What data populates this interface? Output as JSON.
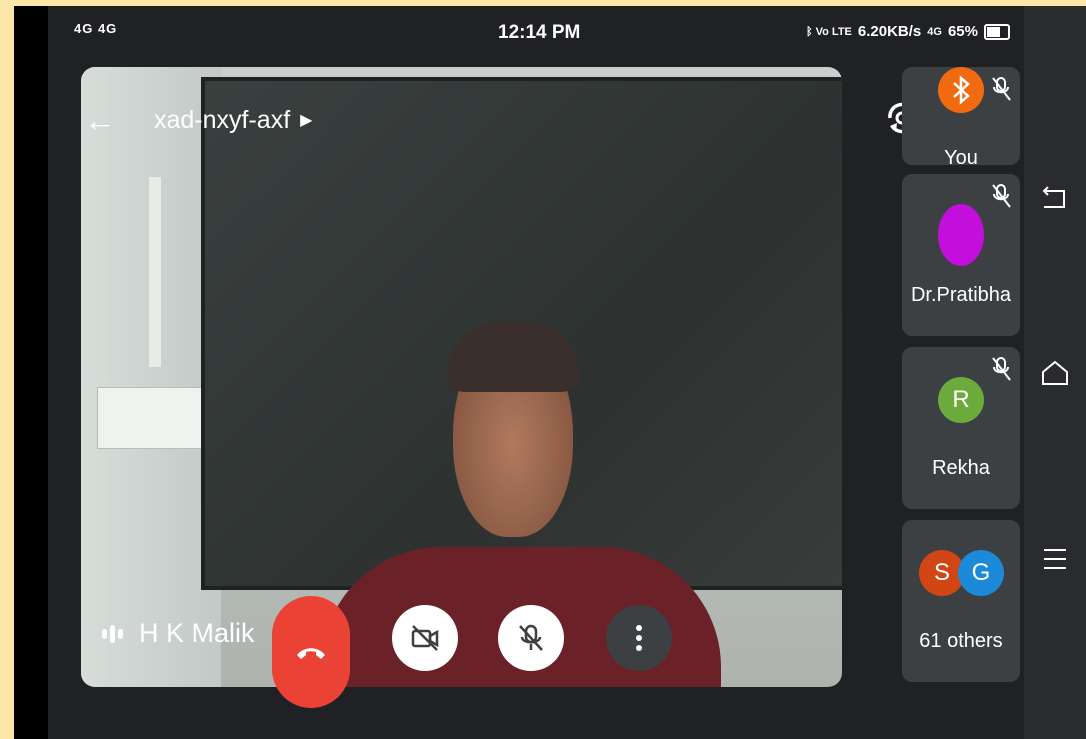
{
  "status_bar": {
    "network": "4G 4G",
    "time": "12:14 PM",
    "bluetooth_volte": "ᛒ Vo LTE",
    "data_speed": "6.20KB/s",
    "network2": "4G",
    "battery_percent": "65%"
  },
  "meeting": {
    "code": "xad-nxyf-axf",
    "active_speaker": "H K Malik"
  },
  "participants": [
    {
      "name": "You",
      "avatar_color": "#f06b10"
    },
    {
      "name": "Dr.Pratibha",
      "avatar_color": "#c20fdb"
    },
    {
      "name": "Rekha",
      "initial": "R",
      "avatar_color": "#6aab3c"
    },
    {
      "name": "61 others",
      "initials": [
        "S",
        "G"
      ],
      "avatar_colors": [
        "#d24515",
        "#1c8ad8"
      ]
    }
  ],
  "controls": {
    "end_call_color": "#ea4335"
  }
}
